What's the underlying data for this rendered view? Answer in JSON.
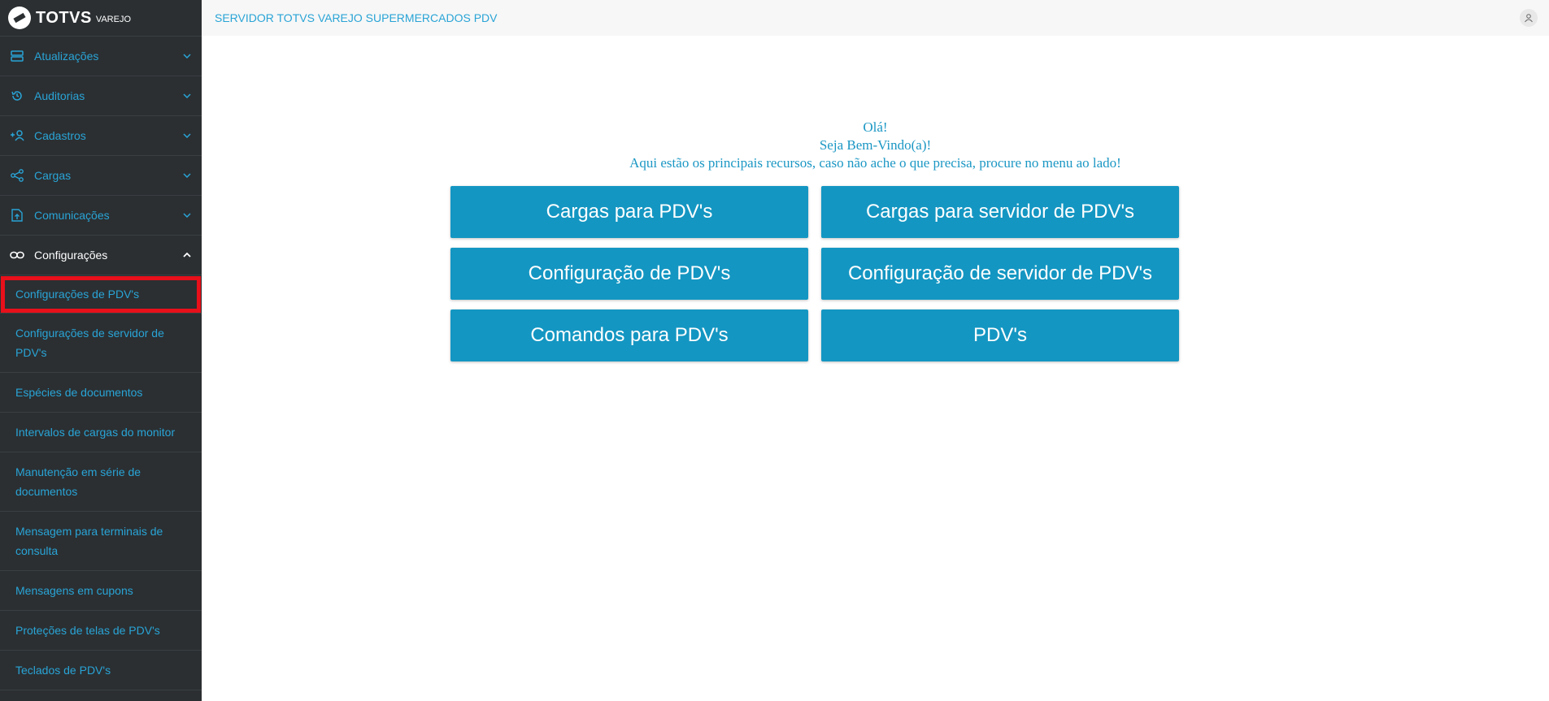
{
  "brand": {
    "name": "TOTVS",
    "sub": "VAREJO"
  },
  "header": {
    "title": "SERVIDOR TOTVS VAREJO SUPERMERCADOS PDV"
  },
  "sidebar": {
    "menus": [
      {
        "label": "Atualizações",
        "icon": "server-icon"
      },
      {
        "label": "Auditorias",
        "icon": "history-icon"
      },
      {
        "label": "Cadastros",
        "icon": "add-user-icon"
      },
      {
        "label": "Cargas",
        "icon": "share-icon"
      },
      {
        "label": "Comunicações",
        "icon": "upload-file-icon"
      },
      {
        "label": "Configurações",
        "icon": "link-icon",
        "expanded": true
      }
    ],
    "submenu": [
      "Configurações de PDV's",
      "Configurações de servidor de PDV's",
      "Espécies de documentos",
      "Intervalos de cargas do monitor",
      "Manutenção em série de documentos",
      "Mensagem para terminais de consulta",
      "Mensagens em cupons",
      "Proteções de telas de PDV's",
      "Teclados de PDV's"
    ]
  },
  "welcome": {
    "line1": "Olá!",
    "line2": "Seja Bem-Vindo(a)!",
    "line3": "Aqui estão os principais recursos, caso não ache o que precisa, procure no menu ao lado!"
  },
  "actions": [
    "Cargas para PDV's",
    "Cargas para servidor de PDV's",
    "Configuração de PDV's",
    "Configuração de servidor de PDV's",
    "Comandos para PDV's",
    "PDV's"
  ],
  "colors": {
    "sidebar": "#2b2f32",
    "accent": "#29a4d6",
    "button": "#1496c2",
    "highlight": "#e8101a"
  }
}
